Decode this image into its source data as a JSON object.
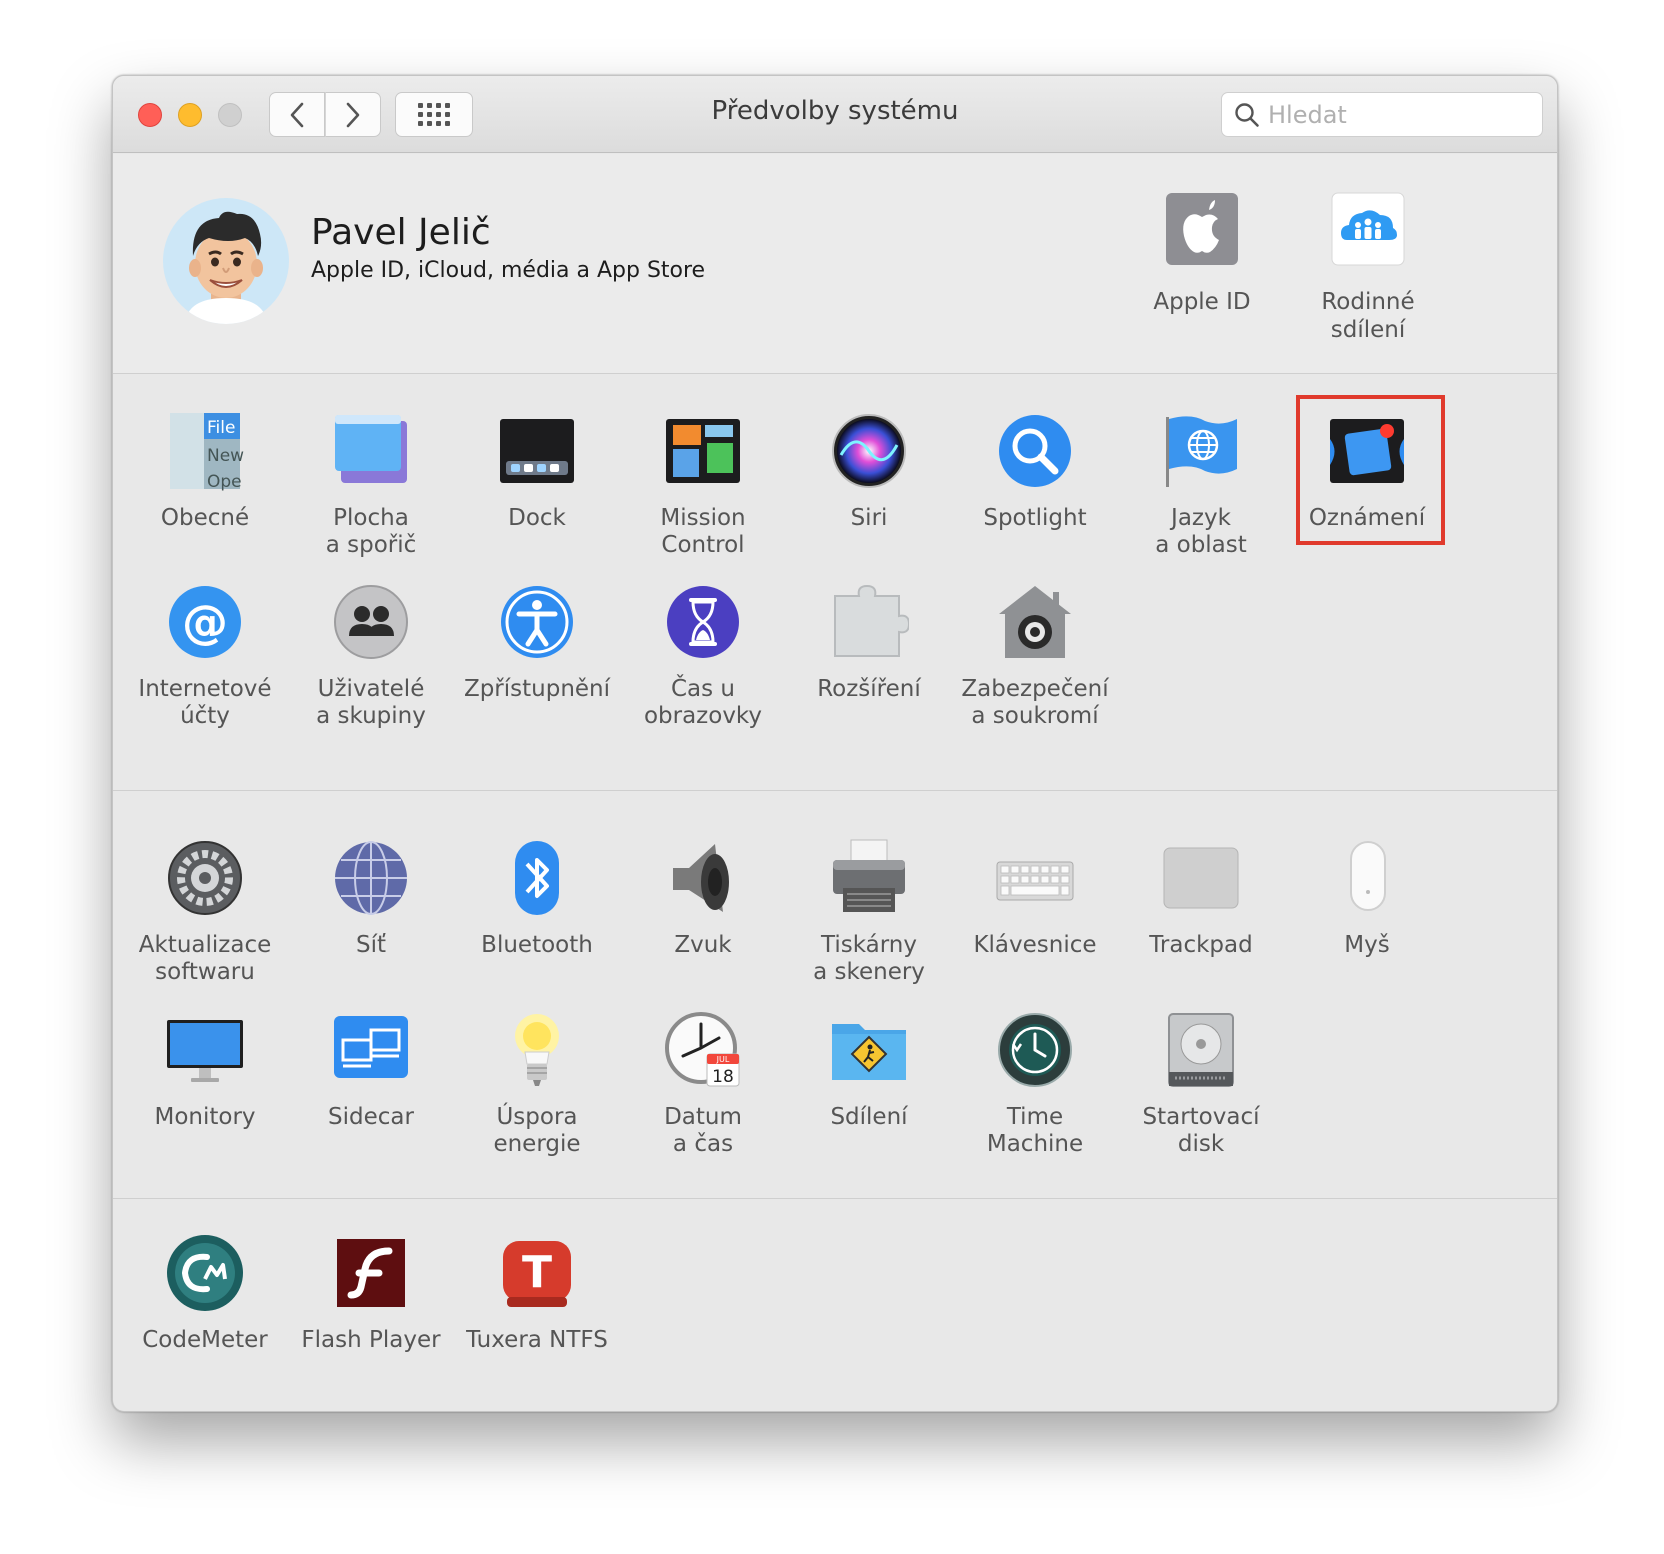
{
  "window": {
    "title": "Předvolby systému",
    "search_placeholder": "Hledat"
  },
  "account": {
    "name": "Pavel Jelič",
    "subtitle": "Apple ID, iCloud, média a App Store",
    "items": [
      {
        "label": "Apple ID"
      },
      {
        "label": "Rodinné\nsdílení"
      }
    ]
  },
  "sections": [
    {
      "rows": [
        [
          {
            "label": "Obecné",
            "icon": "general-icon"
          },
          {
            "label": "Plocha\na spořič",
            "icon": "desktop-icon"
          },
          {
            "label": "Dock",
            "icon": "dock-icon"
          },
          {
            "label": "Mission\nControl",
            "icon": "mission-control-icon"
          },
          {
            "label": "Siri",
            "icon": "siri-icon"
          },
          {
            "label": "Spotlight",
            "icon": "spotlight-icon"
          },
          {
            "label": "Jazyk\na oblast",
            "icon": "language-icon"
          },
          {
            "label": "Oznámení",
            "icon": "notifications-icon",
            "highlighted": true
          }
        ],
        [
          {
            "label": "Internetové\núčty",
            "icon": "internet-accounts-icon"
          },
          {
            "label": "Uživatelé\na skupiny",
            "icon": "users-icon"
          },
          {
            "label": "Zpřístupnění",
            "icon": "accessibility-icon"
          },
          {
            "label": "Čas u obrazovky",
            "icon": "screen-time-icon"
          },
          {
            "label": "Rozšíření",
            "icon": "extensions-icon"
          },
          {
            "label": "Zabezpečení\na soukromí",
            "icon": "security-icon"
          }
        ]
      ]
    },
    {
      "rows": [
        [
          {
            "label": "Aktualizace\nsoftwaru",
            "icon": "software-update-icon"
          },
          {
            "label": "Síť",
            "icon": "network-icon"
          },
          {
            "label": "Bluetooth",
            "icon": "bluetooth-icon"
          },
          {
            "label": "Zvuk",
            "icon": "sound-icon"
          },
          {
            "label": "Tiskárny\na skenery",
            "icon": "printers-icon"
          },
          {
            "label": "Klávesnice",
            "icon": "keyboard-icon"
          },
          {
            "label": "Trackpad",
            "icon": "trackpad-icon"
          },
          {
            "label": "Myš",
            "icon": "mouse-icon"
          }
        ],
        [
          {
            "label": "Monitory",
            "icon": "displays-icon"
          },
          {
            "label": "Sidecar",
            "icon": "sidecar-icon"
          },
          {
            "label": "Úspora\nenergie",
            "icon": "energy-saver-icon"
          },
          {
            "label": "Datum\na čas",
            "icon": "date-time-icon"
          },
          {
            "label": "Sdílení",
            "icon": "sharing-icon"
          },
          {
            "label": "Time\nMachine",
            "icon": "time-machine-icon"
          },
          {
            "label": "Startovací\ndisk",
            "icon": "startup-disk-icon"
          }
        ]
      ]
    },
    {
      "rows": [
        [
          {
            "label": "CodeMeter",
            "icon": "codemeter-icon"
          },
          {
            "label": "Flash Player",
            "icon": "flash-player-icon"
          },
          {
            "label": "Tuxera NTFS",
            "icon": "tuxera-icon"
          }
        ]
      ]
    }
  ],
  "date_icon": {
    "month": "JUL",
    "day": "18"
  }
}
